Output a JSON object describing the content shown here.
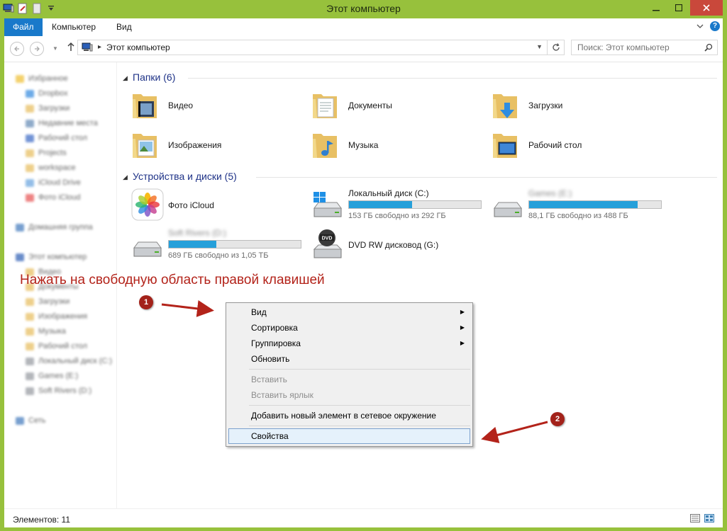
{
  "window": {
    "title": "Этот компьютер"
  },
  "ribbon": {
    "tabs": [
      "Файл",
      "Компьютер",
      "Вид"
    ]
  },
  "address": {
    "path": "Этот компьютер",
    "search_placeholder": "Поиск: Этот компьютер"
  },
  "folders_section": {
    "title": "Папки (6)",
    "items": [
      {
        "label": "Видео",
        "icon": "video-folder-icon"
      },
      {
        "label": "Документы",
        "icon": "documents-folder-icon"
      },
      {
        "label": "Загрузки",
        "icon": "downloads-folder-icon"
      },
      {
        "label": "Изображения",
        "icon": "pictures-folder-icon"
      },
      {
        "label": "Музыка",
        "icon": "music-folder-icon"
      },
      {
        "label": "Рабочий стол",
        "icon": "desktop-folder-icon"
      }
    ]
  },
  "devices_section": {
    "title": "Устройства и диски (5)",
    "items": [
      {
        "name": "Фото iCloud",
        "icon": "icloud-photos-icon"
      },
      {
        "name": "Локальный диск (C:)",
        "free": "153 ГБ свободно из 292 ГБ",
        "used_fraction": 0.48,
        "icon": "local-disk-icon"
      },
      {
        "name": "Games (E:)",
        "free": "88,1 ГБ свободно из 488 ГБ",
        "used_fraction": 0.82,
        "icon": "hard-disk-icon"
      },
      {
        "name": "Soft Rivers (D:)",
        "free": "689 ГБ свободно из 1,05 ТБ",
        "used_fraction": 0.36,
        "icon": "hard-disk-icon"
      },
      {
        "name": "DVD RW дисковод (G:)",
        "icon": "dvd-drive-icon"
      }
    ]
  },
  "sidebar": {
    "items": [
      "Избранное",
      "Dropbox",
      "Загрузки",
      "Недавние места",
      "Рабочий стол",
      "Projects",
      "workspace",
      "iCloud Drive",
      "Фото iCloud",
      "Домашняя группа",
      "Этот компьютер",
      "Видео",
      "Документы",
      "Загрузки",
      "Изображения",
      "Музыка",
      "Рабочий стол",
      "Локальный диск (C:)",
      "Games (E:)",
      "Soft Rivers (D:)",
      "Сеть"
    ]
  },
  "annotation": {
    "text": "Нажать на свободную область правой клавишей",
    "marker1": "1",
    "marker2": "2"
  },
  "context_menu": {
    "items": [
      {
        "label": "Вид",
        "submenu": true
      },
      {
        "label": "Сортировка",
        "submenu": true
      },
      {
        "label": "Группировка",
        "submenu": true
      },
      {
        "label": "Обновить"
      },
      {
        "label": "Вставить",
        "disabled": true
      },
      {
        "label": "Вставить ярлык",
        "disabled": true
      },
      {
        "label": "Добавить новый элемент в сетевое окружение"
      },
      {
        "label": "Свойства",
        "selected": true
      }
    ]
  },
  "status": {
    "text": "Элементов: 11"
  },
  "colors": {
    "title_bar": "#97c13c",
    "accent": "#1979ca",
    "progress": "#26a0da",
    "annotation": "#b3231a"
  }
}
